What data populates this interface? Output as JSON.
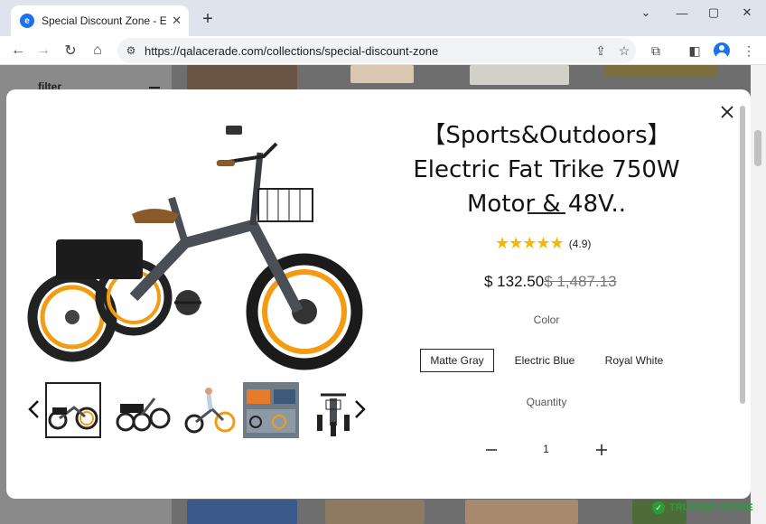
{
  "browser": {
    "tab_title": "Special Discount Zone - Econ-M",
    "tab_favicon": "e",
    "url": "https://qalacerade.com/collections/special-discount-zone",
    "icons": [
      "back-icon",
      "forward-icon",
      "reload-icon",
      "home-icon",
      "site-info-icon",
      "share-icon",
      "bookmark-star-icon",
      "extensions-icon",
      "side-panel-icon",
      "profile-icon",
      "menu-icon"
    ]
  },
  "page": {
    "filter_label": "filter"
  },
  "modal": {
    "title": "【Sports&Outdoors】Electric Fat Trike 750W Motor & 48V..",
    "rating_stars": "★★★★★",
    "rating_value": 4.9,
    "rating_count": "(4.9)",
    "price": "$ 132.50",
    "compare_price": "$ 1,487.13",
    "color_label": "Color",
    "variants": [
      {
        "label": "Matte Gray",
        "selected": true
      },
      {
        "label": "Electric Blue",
        "selected": false
      },
      {
        "label": "Royal White",
        "selected": false
      }
    ],
    "quantity_label": "Quantity",
    "quantity": "1",
    "thumbnails_count": 5
  },
  "trust_badge": {
    "label": "TRUSTED STORE"
  },
  "colors": {
    "accent_orange": "#f39c12",
    "star_yellow": "#f5b800",
    "trusted_green": "#2a9d3a"
  }
}
